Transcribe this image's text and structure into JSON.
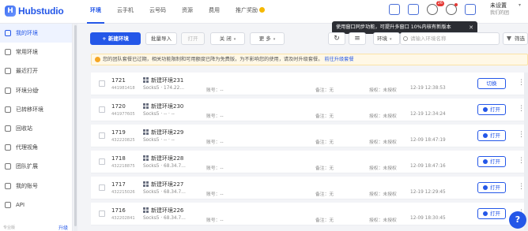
{
  "app": {
    "logo_mark": "H",
    "logo_text": "Hubstudio"
  },
  "nav": [
    {
      "label": "环境",
      "active": true
    },
    {
      "label": "云手机"
    },
    {
      "label": "云号码"
    },
    {
      "label": "资源"
    },
    {
      "label": "费用"
    },
    {
      "label": "推广奖励"
    }
  ],
  "topbar": {
    "notify_count": "26",
    "user_name": "未设置",
    "user_sub": "我们的团",
    "user_caret": "▾"
  },
  "tooltip": {
    "text": "使用窗口同步功能，可提升多窗口 10%内核有新版本",
    "close": "✕"
  },
  "sidebar": {
    "items": [
      {
        "label": "我的环境",
        "icon": "desktop-icon",
        "active": true
      },
      {
        "label": "常用环境",
        "icon": "star-icon"
      },
      {
        "label": "最近打开",
        "icon": "clock-icon"
      },
      {
        "label": "环境分组",
        "icon": "folder-icon",
        "caret": "▾"
      },
      {
        "label": "已转移环境",
        "icon": "transfer-icon"
      },
      {
        "label": "回收站",
        "icon": "trash-icon"
      },
      {
        "label": "代理视角",
        "icon": "globe-icon"
      },
      {
        "label": "团队扩展",
        "icon": "team-icon"
      },
      {
        "label": "我的账号",
        "icon": "account-icon"
      },
      {
        "label": "API",
        "icon": "api-icon"
      }
    ],
    "footer_left": "专业版",
    "footer_right": "升级"
  },
  "toolbar": {
    "new_env": "+ 新建环境",
    "batch_import": "批量导入",
    "open": "打开",
    "close": "关 闭",
    "more": "更 多",
    "caret": "▾",
    "refresh": "↻",
    "view": "≡",
    "scope": "环境",
    "search_placeholder": "请输入环境名称",
    "filter": "筛选"
  },
  "notice": {
    "text": "您的团队套餐已过期，相关功能限制和可用额度已降为免费版，为不影响您的使用，请及时升级套餐。",
    "link": "前往升级套餐"
  },
  "rows": [
    {
      "seq": "1721",
      "serial": "441981418",
      "name": "新建环境231",
      "proxy": "Socks5 · 174.22…",
      "account": "账号：--",
      "note": "备注：无",
      "auth": "授权：未授权",
      "time": "12-19 12:38:53",
      "action": "切换",
      "action_icon": false
    },
    {
      "seq": "1720",
      "serial": "441977605",
      "name": "新建环境230",
      "proxy": "Socks5 · -- · --",
      "account": "账号：--",
      "note": "备注：无",
      "auth": "授权：未授权",
      "time": "12-19 12:34:24",
      "action": "打开",
      "action_icon": true
    },
    {
      "seq": "1719",
      "serial": "432220825",
      "name": "新建环境229",
      "proxy": "Socks5 · -- · --",
      "account": "账号：--",
      "note": "备注：无",
      "auth": "授权：未授权",
      "time": "12-09 18:47:19",
      "action": "打开",
      "action_icon": true
    },
    {
      "seq": "1718",
      "serial": "432218875",
      "name": "新建环境228",
      "proxy": "Socks5 · 68.34.7…",
      "account": "账号：--",
      "note": "备注：无",
      "auth": "授权：未授权",
      "time": "12-09 18:47:16",
      "action": "打开",
      "action_icon": true
    },
    {
      "seq": "1717",
      "serial": "432215026",
      "name": "新建环境227",
      "proxy": "Socks5 · 68.34.7…",
      "account": "账号：--",
      "note": "备注：无",
      "auth": "授权：未授权",
      "time": "12-19 12:29:45",
      "action": "打开",
      "action_icon": true
    },
    {
      "seq": "1716",
      "serial": "432202841",
      "name": "新建环境226",
      "proxy": "Socks5 · 68.34.7…",
      "account": "账号：--",
      "note": "备注：无",
      "auth": "授权：未授权",
      "time": "12-09 18:30:45",
      "action": "打开",
      "action_icon": true
    }
  ],
  "row_more": "⋮",
  "help": "?"
}
